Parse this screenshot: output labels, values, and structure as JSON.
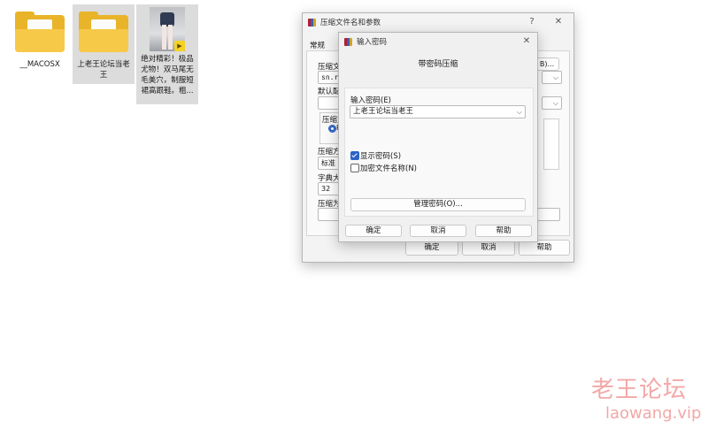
{
  "desktop": {
    "files": [
      {
        "label": "__MACOSX"
      },
      {
        "label": "上老王论坛当老王"
      },
      {
        "label": "绝对精彩！极品尤物！双马尾无毛美穴，制服短裙高跟鞋。粗..."
      }
    ]
  },
  "main_dialog": {
    "title": "压缩文件名和参数",
    "help_glyph": "?",
    "close_glyph": "✕",
    "tab_general": "常规",
    "archive_name_label": "压缩文",
    "archive_name_value": "sn.ra",
    "browse_fragment": "B)...",
    "default_label": "默认配",
    "format_group": "压缩文",
    "format_radio": "R",
    "method_label": "压缩方",
    "method_value": "标准",
    "dict_label": "字典大",
    "dict_value": "32",
    "split_label": "压缩为",
    "ok": "确定",
    "cancel": "取消",
    "help": "帮助"
  },
  "pwd_dialog": {
    "title": "输入密码",
    "close_glyph": "✕",
    "heading": "带密码压缩",
    "enter_label": "输入密码(E)",
    "password_value": "上老王论坛当老王",
    "show_password": {
      "label": "显示密码(S)",
      "checked": true
    },
    "encrypt_names": {
      "label": "加密文件名称(N)",
      "checked": false
    },
    "manage": "管理密码(O)...",
    "ok": "确定",
    "cancel": "取消",
    "help": "帮助"
  },
  "watermark": {
    "line1": "老王论坛",
    "line2": "laowang.vip"
  },
  "colors": {
    "folder": "#f7c948",
    "accent": "#2b63c5",
    "watermark": "#f3a7a7"
  }
}
